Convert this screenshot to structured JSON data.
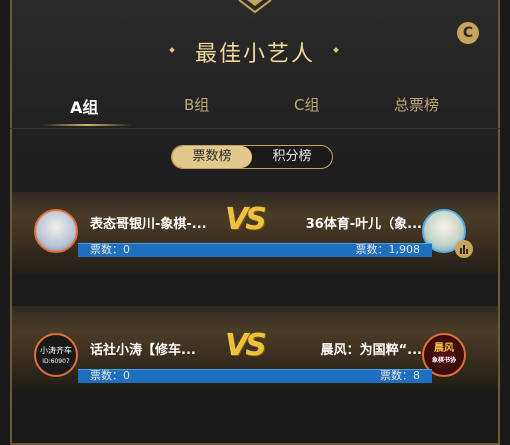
{
  "title": "最佳小艺人",
  "tabs": [
    {
      "label": "A组",
      "active": true
    },
    {
      "label": "B组",
      "active": false
    },
    {
      "label": "C组",
      "active": false
    },
    {
      "label": "总票榜",
      "active": false
    }
  ],
  "segment": {
    "selected": "票数榜",
    "other": "积分榜"
  },
  "matches": [
    {
      "left": {
        "name": "表态哥银川-象棋-...",
        "votes_label": "票数：0"
      },
      "vs": "VS",
      "right": {
        "name": "36体育-叶儿（象...",
        "votes_label": "票数：1,908"
      }
    },
    {
      "left": {
        "name": "话社小涛【修车...",
        "votes_label": "票数：0",
        "avatar_text_1": "小涛齐车",
        "avatar_text_2": "ID:60907"
      },
      "vs": "VS",
      "right": {
        "name": "晨风：为国粹“...",
        "votes_label": "票数：8",
        "avatar_text_1": "晨风",
        "avatar_text_2": "象棋书协"
      }
    }
  ],
  "colors": {
    "gold": "#d9b56c",
    "bar_blue": "#1e6fbf",
    "avatar_border": "#e06f3a"
  },
  "icons": {
    "refresh": "refresh-icon",
    "stats": "bar-chart-icon"
  }
}
